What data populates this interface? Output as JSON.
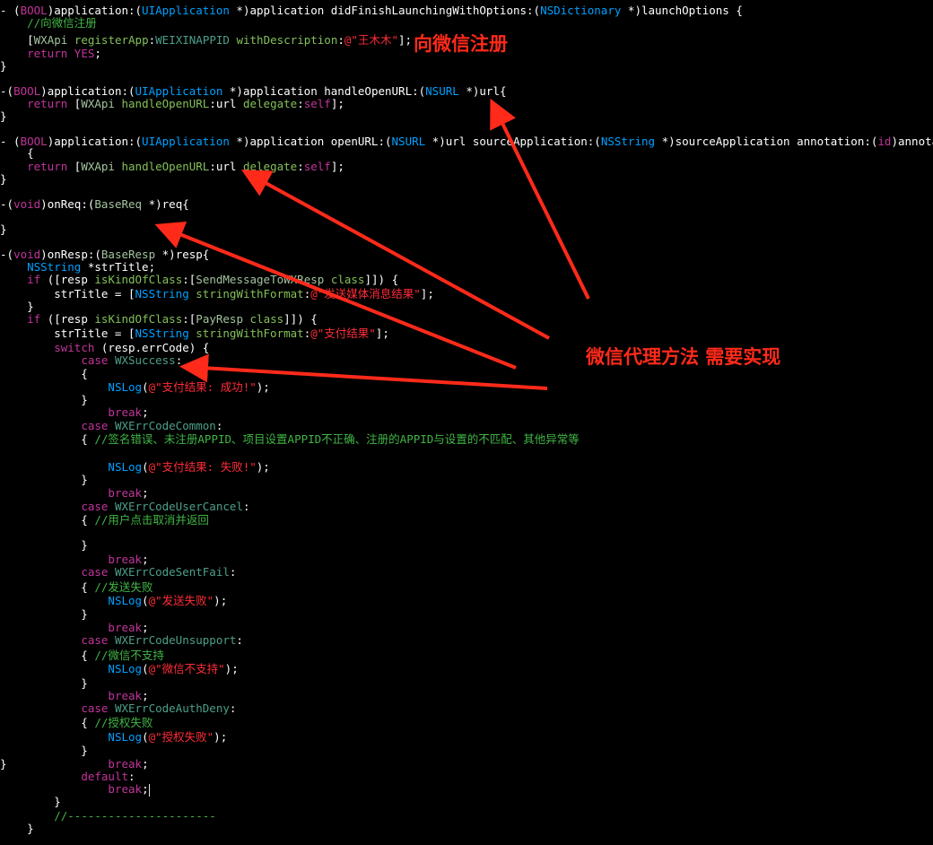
{
  "theme": {
    "background": "#000000",
    "plain": "#ffffff",
    "keyword": "#c2349b",
    "type": "#00a0ff",
    "method": "#83c057",
    "string": "#ff2c38",
    "comment": "#41b645",
    "annotation": "#ff2a1a"
  },
  "annotations": {
    "register": "向微信注册",
    "delegate": "微信代理方法 需要实现"
  },
  "code": [
    [
      [
        "p",
        "- ("
      ],
      [
        "k",
        "BOOL"
      ],
      [
        "p",
        ")application:("
      ],
      [
        "ty",
        "UIApplication"
      ],
      [
        "p",
        " *)application didFinishLaunchingWithOptions:("
      ],
      [
        "ty",
        "NSDictionary"
      ],
      [
        "p",
        " *)launchOptions {"
      ]
    ],
    [
      [
        "p",
        "    "
      ],
      [
        "c",
        "//向微信注册"
      ]
    ],
    [
      [
        "p",
        "    ["
      ],
      [
        "cl",
        "WXApi"
      ],
      [
        "p",
        " "
      ],
      [
        "m",
        "registerApp"
      ],
      [
        "p",
        ":"
      ],
      [
        "cn",
        "WEIXINAPPID"
      ],
      [
        "p",
        " "
      ],
      [
        "m",
        "withDescription"
      ],
      [
        "p",
        ":"
      ],
      [
        "s",
        "@\"王木木\""
      ],
      [
        "p",
        "];"
      ]
    ],
    [
      [
        "p",
        "    "
      ],
      [
        "k",
        "return"
      ],
      [
        "p",
        " "
      ],
      [
        "k",
        "YES"
      ],
      [
        "p",
        ";"
      ]
    ],
    [
      [
        "p",
        "}"
      ]
    ],
    [
      [
        "p",
        "-("
      ],
      [
        "k",
        "BOOL"
      ],
      [
        "p",
        ")application:("
      ],
      [
        "ty",
        "UIApplication"
      ],
      [
        "p",
        " *)application handleOpenURL:("
      ],
      [
        "ty",
        "NSURL"
      ],
      [
        "p",
        " *)url{"
      ]
    ],
    [
      [
        "p",
        "    "
      ],
      [
        "k",
        "return"
      ],
      [
        "p",
        " ["
      ],
      [
        "cl",
        "WXApi"
      ],
      [
        "p",
        " "
      ],
      [
        "m",
        "handleOpenURL"
      ],
      [
        "p",
        ":url "
      ],
      [
        "m",
        "delegate"
      ],
      [
        "p",
        ":"
      ],
      [
        "k",
        "self"
      ],
      [
        "p",
        "];"
      ]
    ],
    [
      [
        "p",
        "}"
      ]
    ],
    [
      [
        "p",
        "- ("
      ],
      [
        "k",
        "BOOL"
      ],
      [
        "p",
        ")application:("
      ],
      [
        "ty",
        "UIApplication"
      ],
      [
        "p",
        " *)application openURL:("
      ],
      [
        "ty",
        "NSURL"
      ],
      [
        "p",
        " *)url sourceApplication:("
      ],
      [
        "ty",
        "NSString"
      ],
      [
        "p",
        " *)sourceApplication annotation:("
      ],
      [
        "k",
        "id"
      ],
      [
        "p",
        ")annotation"
      ]
    ],
    [
      [
        "p",
        "    {"
      ]
    ],
    [
      [
        "p",
        "    "
      ],
      [
        "k",
        "return"
      ],
      [
        "p",
        " ["
      ],
      [
        "cl",
        "WXApi"
      ],
      [
        "p",
        " "
      ],
      [
        "m",
        "handleOpenURL"
      ],
      [
        "p",
        ":url "
      ],
      [
        "m",
        "delegate"
      ],
      [
        "p",
        ":"
      ],
      [
        "k",
        "self"
      ],
      [
        "p",
        "];"
      ]
    ],
    [
      [
        "p",
        "}"
      ]
    ],
    [
      [
        "p",
        "-("
      ],
      [
        "k",
        "void"
      ],
      [
        "p",
        ")onReq:("
      ],
      [
        "cl",
        "BaseReq"
      ],
      [
        "p",
        " *)req{"
      ]
    ],
    [
      [
        "p",
        "}"
      ]
    ],
    [
      [
        "p",
        "-("
      ],
      [
        "k",
        "void"
      ],
      [
        "p",
        ")onResp:("
      ],
      [
        "cl",
        "BaseResp"
      ],
      [
        "p",
        " *)resp{"
      ]
    ],
    [
      [
        "p",
        "    "
      ],
      [
        "ty",
        "NSString"
      ],
      [
        "p",
        " *strTitle;"
      ]
    ],
    [
      [
        "p",
        "    "
      ],
      [
        "k",
        "if"
      ],
      [
        "p",
        " ([resp "
      ],
      [
        "m",
        "isKindOfClass"
      ],
      [
        "p",
        ":["
      ],
      [
        "cl",
        "SendMessageToWXResp"
      ],
      [
        "p",
        " "
      ],
      [
        "m",
        "class"
      ],
      [
        "p",
        "]]) {"
      ]
    ],
    [
      [
        "p",
        "        strTitle = ["
      ],
      [
        "ty",
        "NSString"
      ],
      [
        "p",
        " "
      ],
      [
        "m",
        "stringWithFormat"
      ],
      [
        "p",
        ":"
      ],
      [
        "s",
        "@\"发送媒体消息结果\""
      ],
      [
        "p",
        "];"
      ]
    ],
    [
      [
        "p",
        "    }"
      ]
    ],
    [
      [
        "p",
        "    "
      ],
      [
        "k",
        "if"
      ],
      [
        "p",
        " ([resp "
      ],
      [
        "m",
        "isKindOfClass"
      ],
      [
        "p",
        ":["
      ],
      [
        "cl",
        "PayResp"
      ],
      [
        "p",
        " "
      ],
      [
        "m",
        "class"
      ],
      [
        "p",
        "]]) {"
      ]
    ],
    [
      [
        "p",
        "        strTitle = ["
      ],
      [
        "ty",
        "NSString"
      ],
      [
        "p",
        " "
      ],
      [
        "m",
        "stringWithFormat"
      ],
      [
        "p",
        ":"
      ],
      [
        "s",
        "@\"支付结果\""
      ],
      [
        "p",
        "];"
      ]
    ],
    [
      [
        "p",
        "        "
      ],
      [
        "k",
        "switch"
      ],
      [
        "p",
        " (resp.errCode) {"
      ]
    ],
    [
      [
        "p",
        "            "
      ],
      [
        "k",
        "case"
      ],
      [
        "p",
        " "
      ],
      [
        "cn",
        "WXSuccess"
      ],
      [
        "p",
        ":"
      ]
    ],
    [
      [
        "p",
        "            {"
      ]
    ],
    [
      [
        "p",
        "                "
      ],
      [
        "ty",
        "NSLog"
      ],
      [
        "p",
        "("
      ],
      [
        "s",
        "@\"支付结果: 成功!\""
      ],
      [
        "p",
        ");"
      ]
    ],
    [
      [
        "p",
        "            }"
      ]
    ],
    [
      [
        "p",
        "                "
      ],
      [
        "k",
        "break"
      ],
      [
        "p",
        ";"
      ]
    ],
    [
      [
        "p",
        "            "
      ],
      [
        "k",
        "case"
      ],
      [
        "p",
        " "
      ],
      [
        "cn",
        "WXErrCodeCommon"
      ],
      [
        "p",
        ":"
      ]
    ],
    [
      [
        "p",
        "            { "
      ],
      [
        "c",
        "//签名错误、未注册APPID、项目设置APPID不正确、注册的APPID与设置的不匹配、其他异常等"
      ]
    ],
    [
      [
        "p",
        "                "
      ],
      [
        "ty",
        "NSLog"
      ],
      [
        "p",
        "("
      ],
      [
        "s",
        "@\"支付结果: 失败!\""
      ],
      [
        "p",
        ");"
      ]
    ],
    [
      [
        "p",
        "            }"
      ]
    ],
    [
      [
        "p",
        "                "
      ],
      [
        "k",
        "break"
      ],
      [
        "p",
        ";"
      ]
    ],
    [
      [
        "p",
        "            "
      ],
      [
        "k",
        "case"
      ],
      [
        "p",
        " "
      ],
      [
        "cn",
        "WXErrCodeUserCancel"
      ],
      [
        "p",
        ":"
      ]
    ],
    [
      [
        "p",
        "            { "
      ],
      [
        "c",
        "//用户点击取消并返回"
      ]
    ],
    [
      [
        "p",
        "            }"
      ]
    ],
    [
      [
        "p",
        "                "
      ],
      [
        "k",
        "break"
      ],
      [
        "p",
        ";"
      ]
    ],
    [
      [
        "p",
        "            "
      ],
      [
        "k",
        "case"
      ],
      [
        "p",
        " "
      ],
      [
        "cn",
        "WXErrCodeSentFail"
      ],
      [
        "p",
        ":"
      ]
    ],
    [
      [
        "p",
        "            { "
      ],
      [
        "c",
        "//发送失败"
      ]
    ],
    [
      [
        "p",
        "                "
      ],
      [
        "ty",
        "NSLog"
      ],
      [
        "p",
        "("
      ],
      [
        "s",
        "@\"发送失败\""
      ],
      [
        "p",
        ");"
      ]
    ],
    [
      [
        "p",
        "            }"
      ]
    ],
    [
      [
        "p",
        "                "
      ],
      [
        "k",
        "break"
      ],
      [
        "p",
        ";"
      ]
    ],
    [
      [
        "p",
        "            "
      ],
      [
        "k",
        "case"
      ],
      [
        "p",
        " "
      ],
      [
        "cn",
        "WXErrCodeUnsupport"
      ],
      [
        "p",
        ":"
      ]
    ],
    [
      [
        "p",
        "            { "
      ],
      [
        "c",
        "//微信不支持"
      ]
    ],
    [
      [
        "p",
        "                "
      ],
      [
        "ty",
        "NSLog"
      ],
      [
        "p",
        "("
      ],
      [
        "s",
        "@\"微信不支持\""
      ],
      [
        "p",
        ");"
      ]
    ],
    [
      [
        "p",
        "            }"
      ]
    ],
    [
      [
        "p",
        "                "
      ],
      [
        "k",
        "break"
      ],
      [
        "p",
        ";"
      ]
    ],
    [
      [
        "p",
        "            "
      ],
      [
        "k",
        "case"
      ],
      [
        "p",
        " "
      ],
      [
        "cn",
        "WXErrCodeAuthDeny"
      ],
      [
        "p",
        ":"
      ]
    ],
    [
      [
        "p",
        "            { "
      ],
      [
        "c",
        "//授权失败"
      ]
    ],
    [
      [
        "p",
        "                "
      ],
      [
        "ty",
        "NSLog"
      ],
      [
        "p",
        "("
      ],
      [
        "s",
        "@\"授权失败\""
      ],
      [
        "p",
        ");"
      ]
    ],
    [
      [
        "p",
        "            }"
      ]
    ],
    [
      [
        "p",
        "                "
      ],
      [
        "k",
        "break"
      ],
      [
        "p",
        ";"
      ]
    ],
    [
      [
        "p",
        "            "
      ],
      [
        "k",
        "default"
      ],
      [
        "p",
        ":"
      ]
    ],
    [
      [
        "p",
        "                "
      ],
      [
        "k",
        "break"
      ],
      [
        "p",
        ";"
      ]
    ],
    [
      [
        "p",
        "        }"
      ]
    ],
    [
      [
        "p",
        "        "
      ],
      [
        "c",
        "//----------------------"
      ]
    ],
    [
      [
        "p",
        "    }"
      ]
    ],
    [
      [
        "p",
        "}"
      ]
    ]
  ]
}
